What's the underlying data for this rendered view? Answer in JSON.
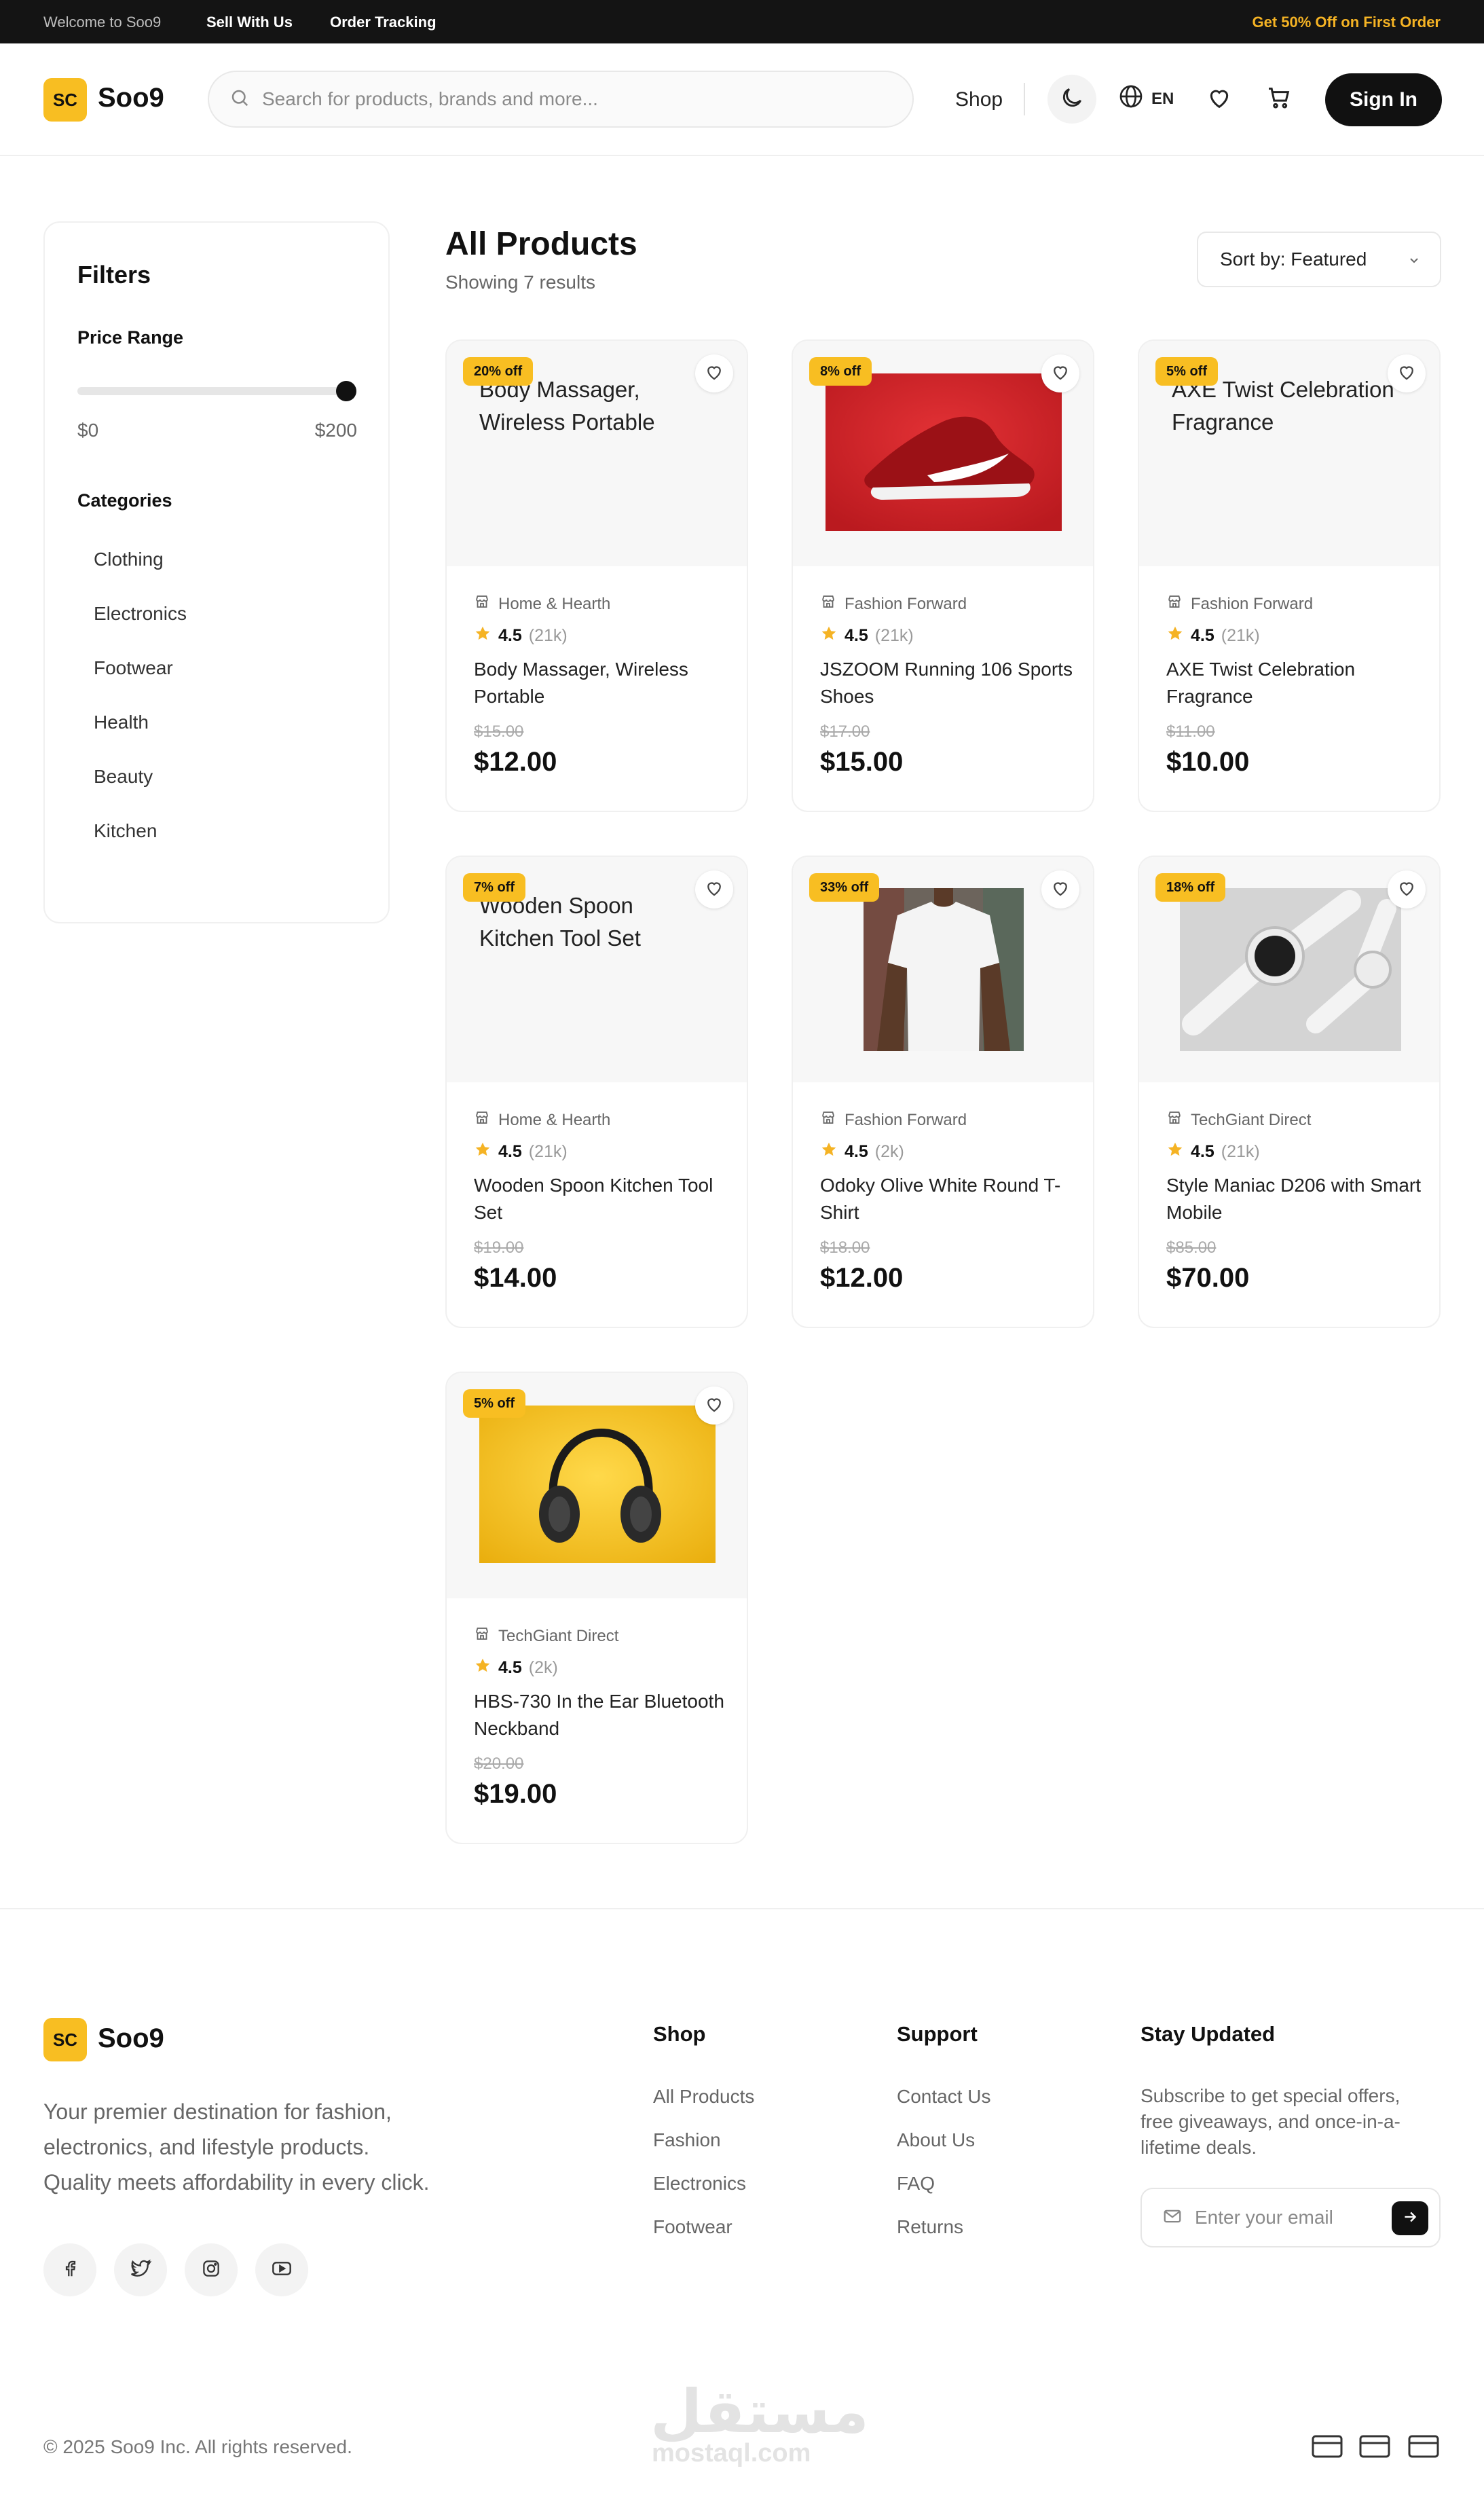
{
  "topbar": {
    "welcome": "Welcome to Soo9",
    "sell": "Sell With Us",
    "tracking": "Order Tracking",
    "promo": "Get 50% Off on First Order"
  },
  "header": {
    "logo_badge": "SC",
    "logo_text": "Soo9",
    "search_placeholder": "Search for products, brands and more...",
    "shop": "Shop",
    "lang": "EN",
    "signin": "Sign In"
  },
  "filters": {
    "title": "Filters",
    "price_range": "Price Range",
    "price_value_fraction": 1.0,
    "min_label": "$0",
    "max_label": "$200",
    "categories_title": "Categories",
    "categories": [
      "Clothing",
      "Electronics",
      "Footwear",
      "Health",
      "Beauty",
      "Kitchen"
    ]
  },
  "products_header": {
    "title": "All Products",
    "results": "Showing 7 results",
    "sort": "Sort by: Featured"
  },
  "products": [
    {
      "badge": "20% off",
      "image": "missing",
      "alt": "Body Massager, Wireless Portable",
      "seller": "Home & Hearth",
      "rating": "4.5",
      "count": "(21k)",
      "name": "Body Massager, Wireless Portable",
      "old_price": "$15.00",
      "price": "$12.00"
    },
    {
      "badge": "8% off",
      "image": "shoe",
      "alt": "",
      "seller": "Fashion Forward",
      "rating": "4.5",
      "count": "(21k)",
      "name": "JSZOOM Running 106 Sports Shoes",
      "old_price": "$17.00",
      "price": "$15.00"
    },
    {
      "badge": "5% off",
      "image": "missing",
      "alt": "AXE Twist Celebration Fragrance",
      "seller": "Fashion Forward",
      "rating": "4.5",
      "count": "(21k)",
      "name": "AXE Twist Celebration Fragrance",
      "old_price": "$11.00",
      "price": "$10.00"
    },
    {
      "badge": "7% off",
      "image": "missing",
      "alt": "Wooden Spoon Kitchen Tool Set",
      "seller": "Home & Hearth",
      "rating": "4.5",
      "count": "(21k)",
      "name": "Wooden Spoon Kitchen Tool Set",
      "old_price": "$19.00",
      "price": "$14.00"
    },
    {
      "badge": "33% off",
      "image": "tshirt",
      "alt": "",
      "seller": "Fashion Forward",
      "rating": "4.5",
      "count": "(2k)",
      "name": "Odoky Olive White Round T-Shirt",
      "old_price": "$18.00",
      "price": "$12.00"
    },
    {
      "badge": "18% off",
      "image": "watch",
      "alt": "",
      "seller": "TechGiant Direct",
      "rating": "4.5",
      "count": "(21k)",
      "name": "Style Maniac D206 with Smart Mobile",
      "old_price": "$85.00",
      "price": "$70.00"
    },
    {
      "badge": "5% off",
      "image": "headphones",
      "alt": "",
      "seller": "TechGiant Direct",
      "rating": "4.5",
      "count": "(2k)",
      "name": "HBS-730 In the Ear Bluetooth Neckband",
      "old_price": "$20.00",
      "price": "$19.00"
    }
  ],
  "footer": {
    "logo_badge": "SC",
    "logo_text": "Soo9",
    "desc_lines": [
      "Your premier destination for fashion,",
      "electronics, and lifestyle products.",
      "Quality meets affordability in every click."
    ],
    "shop_title": "Shop",
    "shop_links": [
      "All Products",
      "Fashion",
      "Electronics",
      "Footwear"
    ],
    "support_title": "Support",
    "support_links": [
      "Contact Us",
      "About Us",
      "FAQ",
      "Returns"
    ],
    "newsletter_title": "Stay Updated",
    "newsletter_lines": [
      "Subscribe to get special offers,",
      "free giveaways, and once-in-a-",
      "lifetime deals."
    ],
    "email_placeholder": "Enter your email",
    "copyright": "© 2025 Soo9 Inc. All rights reserved.",
    "watermark_ar": "مستقل",
    "watermark_en": "mostaql.com",
    "social_icons": [
      "facebook-icon",
      "twitter-icon",
      "instagram-icon",
      "youtube-icon"
    ],
    "payment_icons": [
      "card-icon",
      "card-icon",
      "card-icon"
    ]
  },
  "colors": {
    "accent": "#f8be22",
    "dark": "#111111",
    "promo": "#f5b324"
  }
}
